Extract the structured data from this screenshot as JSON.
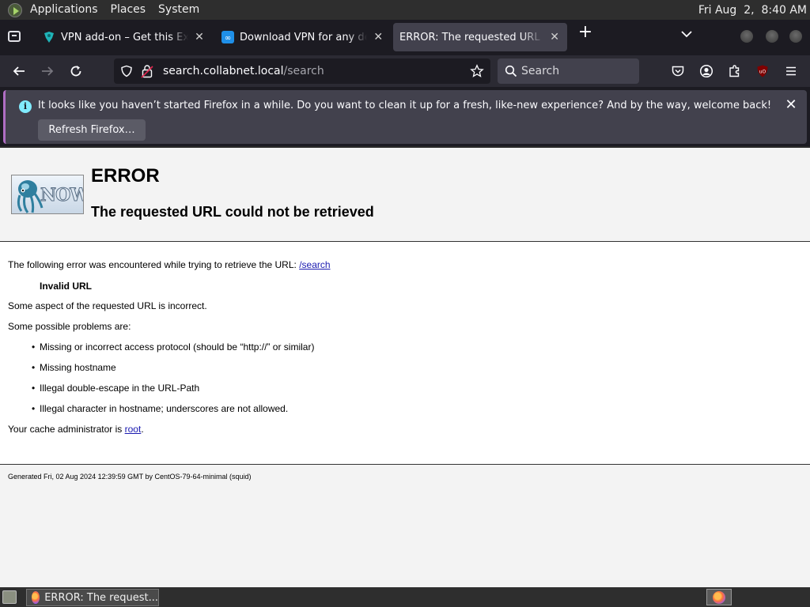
{
  "top_panel": {
    "menus": [
      "Applications",
      "Places",
      "System"
    ],
    "clock": "Fri Aug  2,  8:40 AM"
  },
  "tabs": [
    {
      "title": "VPN add-on – Get this Extension",
      "favicon": "vpn-addon-icon",
      "active": false
    },
    {
      "title": "Download VPN for any device",
      "favicon": "vpn-download-icon",
      "active": false
    },
    {
      "title": "ERROR: The requested URL could not be retrieved",
      "favicon": "none",
      "active": true
    }
  ],
  "toolbar": {
    "url_host": "search.collabnet.local",
    "url_path": "/search",
    "search_placeholder": "Search"
  },
  "notification": {
    "message": "It looks like you haven’t started Firefox in a while. Do you want to clean it up for a fresh, like-new experience? And by the way, welcome back!",
    "button_label": "Refresh Firefox…"
  },
  "page": {
    "logo_text": "NOW",
    "title": "ERROR",
    "subtitle": "The requested URL could not be retrieved",
    "intro": "The following error was encountered while trying to retrieve the URL: ",
    "url_link": "/search",
    "error_code": "Invalid URL",
    "description": "Some aspect of the requested URL is incorrect.",
    "problems_heading": "Some possible problems are:",
    "problems": [
      "Missing or incorrect access protocol (should be “http://” or similar)",
      "Missing hostname",
      "Illegal double-escape in the URL-Path",
      "Illegal character in hostname; underscores are not allowed."
    ],
    "admin_prefix": "Your cache administrator is ",
    "admin_link": "root",
    "admin_suffix": ".",
    "footer": "Generated Fri, 02 Aug 2024 12:39:59 GMT by CentOS-79-64-minimal (squid)"
  },
  "taskbar": {
    "window_title": "ERROR: The request..."
  },
  "colors": {
    "accent_notification_border": "#b06ec4",
    "link": "#1a1ab0",
    "info_icon": "#80ebff"
  }
}
